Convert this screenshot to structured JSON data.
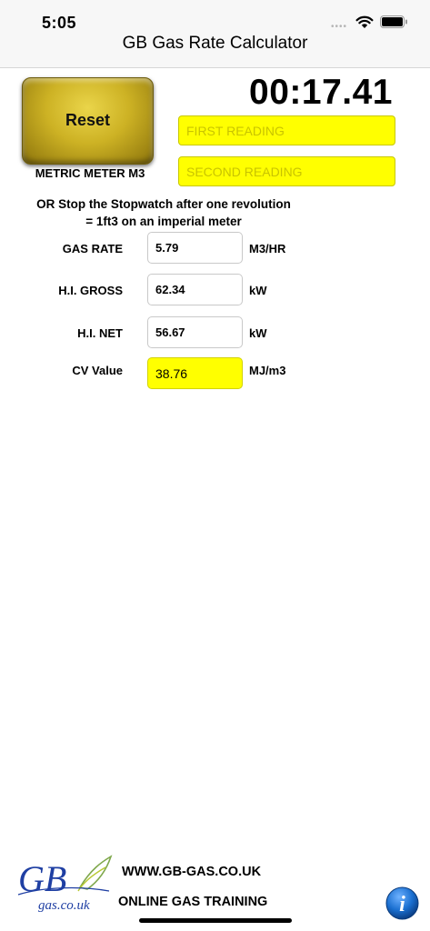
{
  "status_bar": {
    "time": "5:05",
    "dots": "••••",
    "icons": [
      "wifi-icon",
      "battery-icon"
    ]
  },
  "nav": {
    "title": "GB Gas Rate Calculator"
  },
  "controls": {
    "reset_label": "Reset",
    "meter_label": "METRIC METER M3",
    "timer": "00:17.41",
    "first_reading_placeholder": "FIRST READING",
    "second_reading_placeholder": "SECOND READING",
    "first_reading_value": "",
    "second_reading_value": ""
  },
  "info": {
    "line1": "OR Stop the Stopwatch after one revolution",
    "line2": "= 1ft3 on an imperial meter"
  },
  "results": [
    {
      "label": "GAS RATE",
      "value": "5.79",
      "unit": "M3/HR"
    },
    {
      "label": "H.I. GROSS",
      "value": "62.34",
      "unit": "kW"
    },
    {
      "label": "H.I. NET",
      "value": "56.67",
      "unit": "kW"
    },
    {
      "label": "CV Value",
      "value": "38.76",
      "unit": "MJ/m3"
    }
  ],
  "footer": {
    "logo_text": "GB",
    "logo_subtext": "gas.co.uk",
    "website": "WWW.GB-GAS.CO.UK",
    "training": "ONLINE GAS TRAINING",
    "info_icon": "i"
  },
  "colors": {
    "highlight": "#ffff00",
    "button_gold": "#cdb224",
    "info_blue": "#1a6fd0",
    "logo_blue": "#1f3fa3"
  }
}
